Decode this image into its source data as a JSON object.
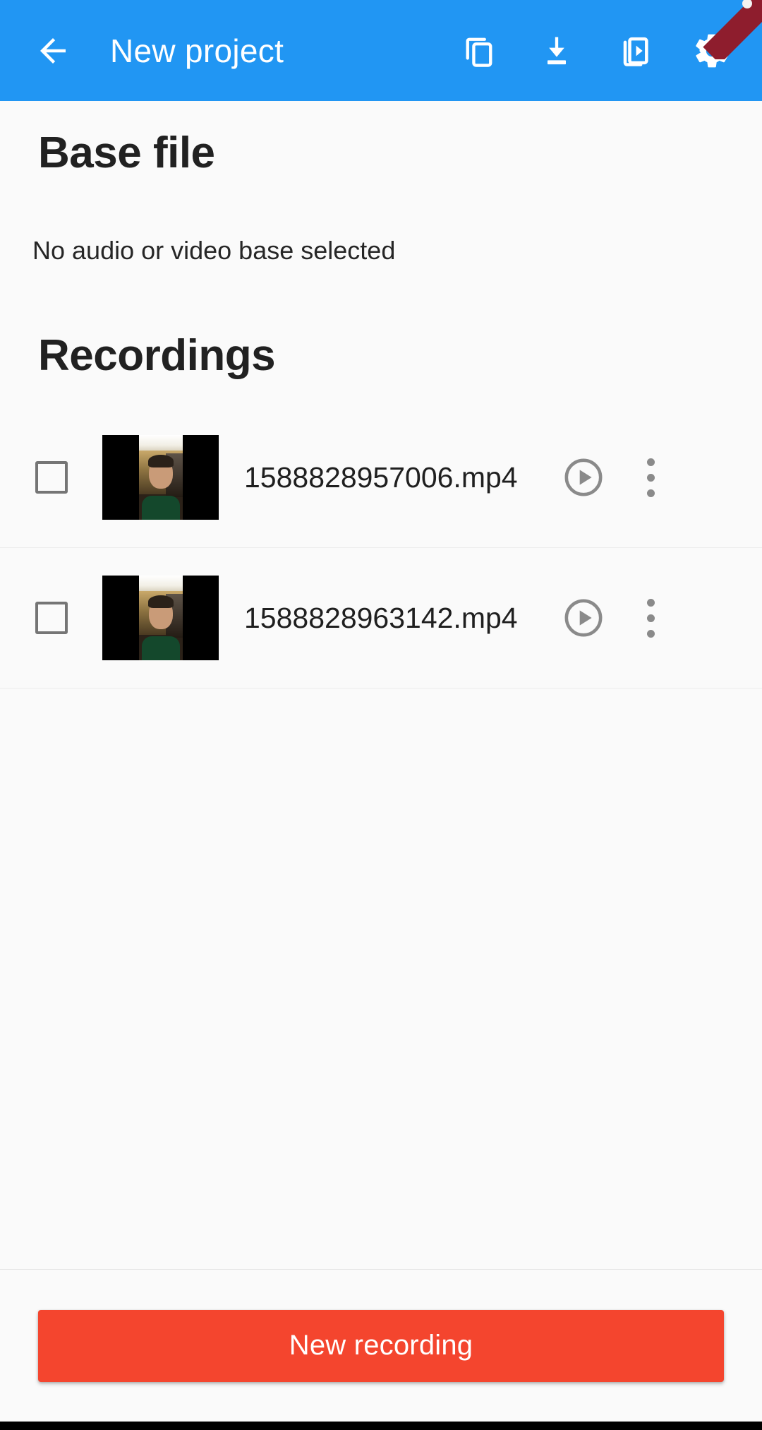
{
  "appbar": {
    "back_label": "back-arrow",
    "title": "New project",
    "actions": [
      {
        "name": "duplicate-icon",
        "label": "Duplicate"
      },
      {
        "name": "download-icon",
        "label": "Download"
      },
      {
        "name": "export-video-icon",
        "label": "Export video"
      },
      {
        "name": "settings-gear-icon",
        "label": "Settings"
      }
    ],
    "background_color": "#2196F3",
    "ribbon_color": "#8e1d2d"
  },
  "base_file": {
    "heading": "Base file",
    "empty_text": "No audio or video base selected"
  },
  "recordings": {
    "heading": "Recordings",
    "items": [
      {
        "checked": false,
        "filename": "1588828957006.mp4",
        "play_label": "Play",
        "more_label": "More options"
      },
      {
        "checked": false,
        "filename": "1588828963142.mp4",
        "play_label": "Play",
        "more_label": "More options"
      }
    ]
  },
  "bottom": {
    "new_recording_label": "New recording",
    "button_color": "#f4452e"
  }
}
